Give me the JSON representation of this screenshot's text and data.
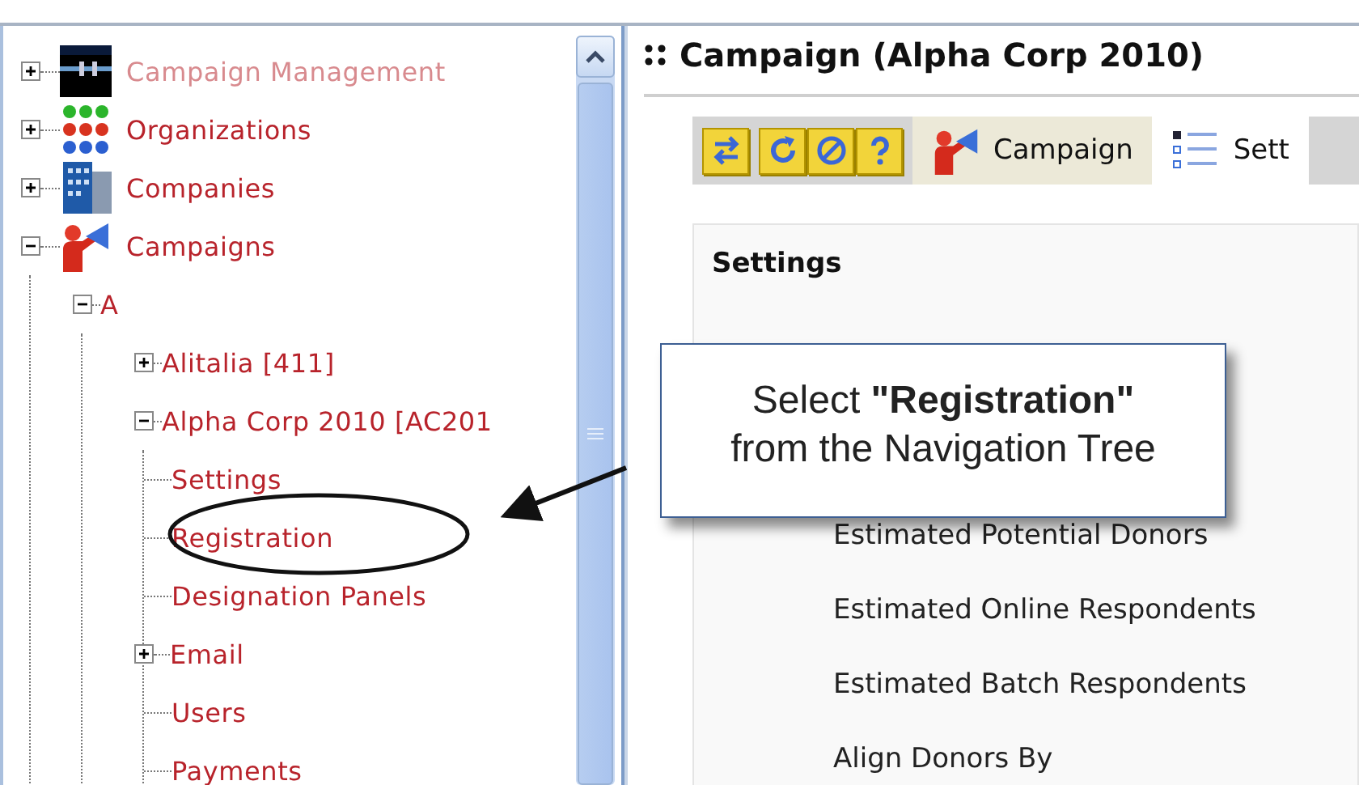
{
  "tree": [
    {
      "label": "Campaign Management",
      "kind": "branch",
      "expanded": false,
      "disabled": true
    },
    {
      "label": "Organizations",
      "kind": "branch",
      "expanded": false,
      "disabled": false
    },
    {
      "label": "Companies",
      "kind": "branch",
      "expanded": false,
      "disabled": false
    },
    {
      "label": "Campaigns",
      "kind": "branch",
      "expanded": true,
      "disabled": false,
      "children": [
        {
          "label": "A",
          "kind": "branch",
          "expanded": true,
          "disabled": false,
          "children": [
            {
              "label": "Alitalia [411]",
              "kind": "branch",
              "expanded": false,
              "disabled": false
            },
            {
              "label": "Alpha Corp 2010 [AC201",
              "kind": "branch",
              "expanded": true,
              "disabled": false,
              "children": [
                {
                  "label": "Settings",
                  "kind": "leaf",
                  "disabled": false
                },
                {
                  "label": "Registration",
                  "kind": "leaf",
                  "disabled": false
                },
                {
                  "label": "Designation Panels",
                  "kind": "leaf",
                  "disabled": false
                },
                {
                  "label": "Email",
                  "kind": "branch",
                  "expanded": false,
                  "disabled": false
                },
                {
                  "label": "Users",
                  "kind": "leaf",
                  "disabled": false
                },
                {
                  "label": "Payments",
                  "kind": "leaf",
                  "disabled": false
                }
              ]
            }
          ]
        }
      ]
    }
  ],
  "page_title": "Campaign (Alpha Corp 2010)",
  "tabs": [
    {
      "label": "Campaign",
      "selected": true
    },
    {
      "label": "Sett",
      "selected": false
    }
  ],
  "panel": {
    "title": "Settings",
    "fields": [
      "Estimated Potential Donors",
      "Estimated Online Respondents",
      "Estimated Batch Respondents",
      "Align Donors By"
    ]
  },
  "callout": {
    "text": "Select **\"Registration\"**\nfrom the Navigation Tree"
  }
}
